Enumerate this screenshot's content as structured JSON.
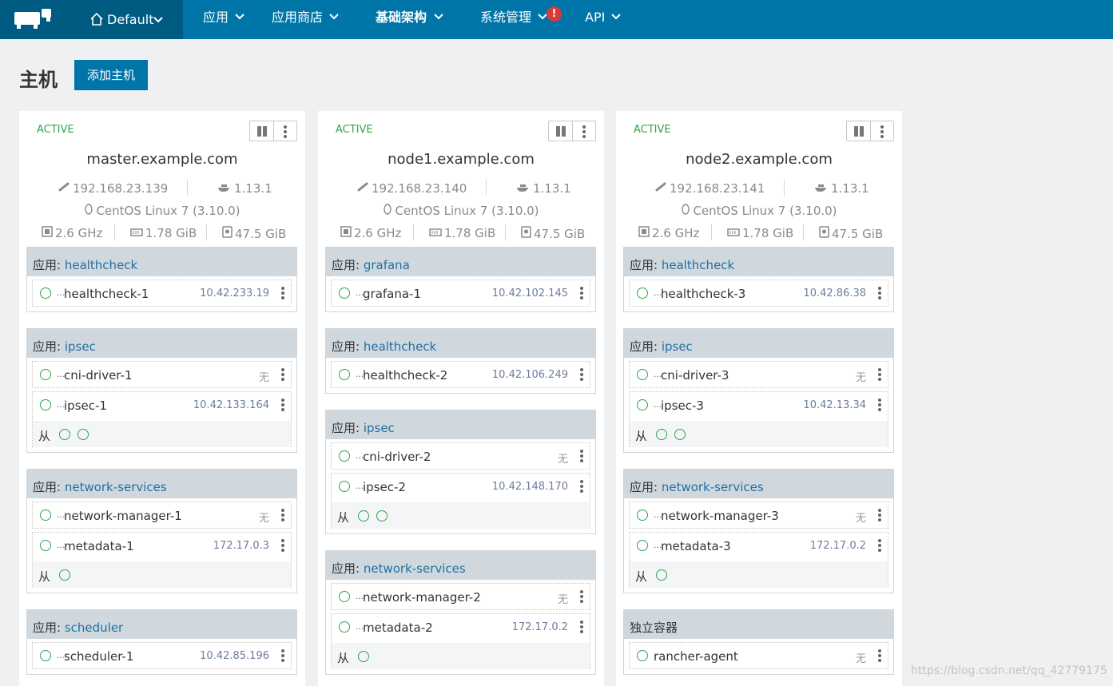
{
  "nav": {
    "environment": "Default",
    "items": [
      {
        "label": "应用"
      },
      {
        "label": "应用商店"
      },
      {
        "label": "基础架构"
      },
      {
        "label": "系统管理"
      },
      {
        "label": "API"
      }
    ],
    "alert_badge": "!"
  },
  "header": {
    "title": "主机",
    "add_button": "添加主机"
  },
  "hosts": [
    {
      "state": "ACTIVE",
      "hostname": "master.example.com",
      "ip": "192.168.23.139",
      "docker": "1.13.1",
      "os": "CentOS Linux 7 (3.10.0)",
      "cpu": "2.6 GHz",
      "ram": "1.78 GiB",
      "disk": "47.5 GiB",
      "services": [
        {
          "prefix": "应用: ",
          "name": "healthcheck",
          "containers": [
            {
              "ellipsis": "...",
              "name": "healthcheck-1",
              "ip": "10.42.233.19"
            }
          ]
        },
        {
          "prefix": "应用: ",
          "name": "ipsec",
          "containers": [
            {
              "ellipsis": "...",
              "name": "cni-driver-1",
              "ip": "无"
            },
            {
              "ellipsis": "...",
              "name": "ipsec-1",
              "ip": "10.42.133.164",
              "sidekick_label": "从"
            }
          ]
        },
        {
          "prefix": "应用: ",
          "name": "network-services",
          "containers": [
            {
              "ellipsis": "...",
              "name": "network-manager-1",
              "ip": "无"
            },
            {
              "ellipsis": "...",
              "name": "metadata-1",
              "ip": "172.17.0.3",
              "sidekick_label": "从"
            }
          ]
        },
        {
          "prefix": "应用: ",
          "name": "scheduler",
          "containers": [
            {
              "ellipsis": "...",
              "name": "scheduler-1",
              "ip": "10.42.85.196"
            }
          ]
        }
      ]
    },
    {
      "state": "ACTIVE",
      "hostname": "node1.example.com",
      "ip": "192.168.23.140",
      "docker": "1.13.1",
      "os": "CentOS Linux 7 (3.10.0)",
      "cpu": "2.6 GHz",
      "ram": "1.78 GiB",
      "disk": "47.5 GiB",
      "services": [
        {
          "prefix": "应用: ",
          "name": "grafana",
          "containers": [
            {
              "ellipsis": "...",
              "name": "grafana-1",
              "ip": "10.42.102.145"
            }
          ]
        },
        {
          "prefix": "应用: ",
          "name": "healthcheck",
          "containers": [
            {
              "ellipsis": "...",
              "name": "healthcheck-2",
              "ip": "10.42.106.249"
            }
          ]
        },
        {
          "prefix": "应用: ",
          "name": "ipsec",
          "containers": [
            {
              "ellipsis": "...",
              "name": "cni-driver-2",
              "ip": "无"
            },
            {
              "ellipsis": "...",
              "name": "ipsec-2",
              "ip": "10.42.148.170",
              "sidekick_label": "从"
            }
          ]
        },
        {
          "prefix": "应用: ",
          "name": "network-services",
          "containers": [
            {
              "ellipsis": "...",
              "name": "network-manager-2",
              "ip": "无"
            },
            {
              "ellipsis": "...",
              "name": "metadata-2",
              "ip": "172.17.0.2",
              "sidekick_label": "从"
            }
          ]
        }
      ]
    },
    {
      "state": "ACTIVE",
      "hostname": "node2.example.com",
      "ip": "192.168.23.141",
      "docker": "1.13.1",
      "os": "CentOS Linux 7 (3.10.0)",
      "cpu": "2.6 GHz",
      "ram": "1.78 GiB",
      "disk": "47.5 GiB",
      "services": [
        {
          "prefix": "应用: ",
          "name": "healthcheck",
          "containers": [
            {
              "ellipsis": "...",
              "name": "healthcheck-3",
              "ip": "10.42.86.38"
            }
          ]
        },
        {
          "prefix": "应用: ",
          "name": "ipsec",
          "containers": [
            {
              "ellipsis": "...",
              "name": "cni-driver-3",
              "ip": "无"
            },
            {
              "ellipsis": "...",
              "name": "ipsec-3",
              "ip": "10.42.13.34",
              "sidekick_label": "从"
            }
          ]
        },
        {
          "prefix": "应用: ",
          "name": "network-services",
          "containers": [
            {
              "ellipsis": "...",
              "name": "network-manager-3",
              "ip": "无"
            },
            {
              "ellipsis": "...",
              "name": "metadata-3",
              "ip": "172.17.0.2",
              "sidekick_label": "从"
            }
          ]
        },
        {
          "prefix": "",
          "name": "独立容器",
          "containers": [
            {
              "ellipsis": "",
              "name": "rancher-agent",
              "ip": "无"
            }
          ]
        }
      ]
    }
  ],
  "watermark": "https://blog.csdn.net/qq_42779175",
  "colors": {
    "nav_bg": "#0075a8",
    "nav_dark": "#005b83",
    "active_green": "#31a24c",
    "link_blue": "#1f70a3"
  }
}
